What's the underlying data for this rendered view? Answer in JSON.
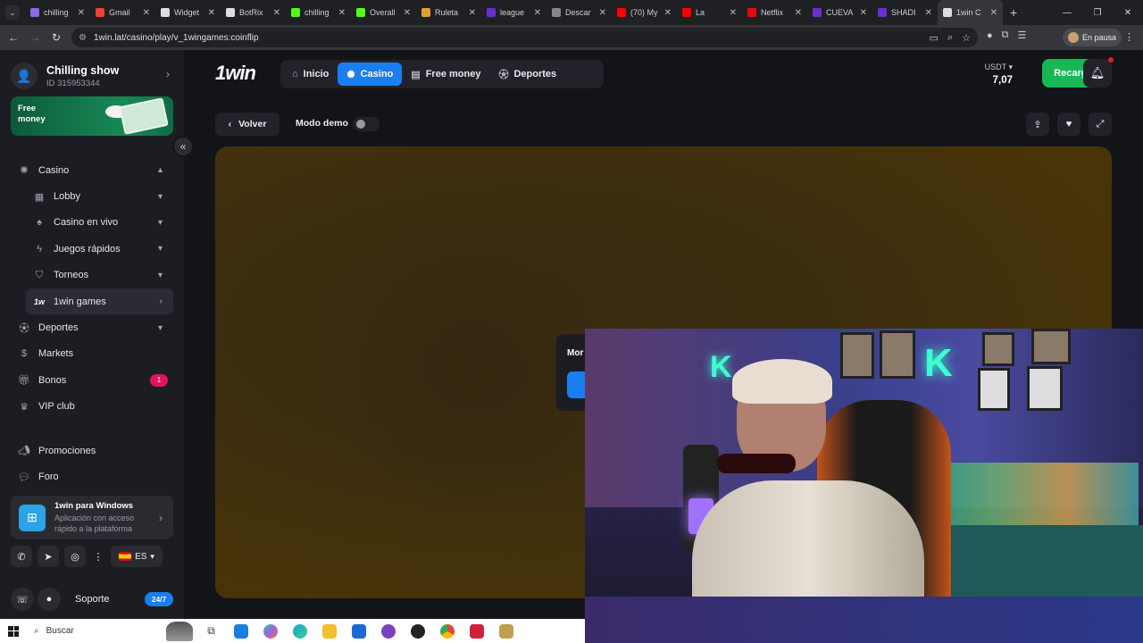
{
  "browser": {
    "tabs": [
      {
        "title": "chilling",
        "color": "#8a6ae0"
      },
      {
        "title": "Gmail",
        "color": "#ea4335"
      },
      {
        "title": "Widget",
        "color": "#dddddd"
      },
      {
        "title": "BotRix",
        "color": "#dddddd"
      },
      {
        "title": "chilling",
        "color": "#53fc18"
      },
      {
        "title": "Overall",
        "color": "#53fc18"
      },
      {
        "title": "Ruleta",
        "color": "#e0a030"
      },
      {
        "title": "league",
        "color": "#6b2fd0"
      },
      {
        "title": "Descar",
        "color": "#888888"
      },
      {
        "title": "(70) My",
        "color": "#ff0000"
      },
      {
        "title": "La",
        "color": "#ff0000"
      },
      {
        "title": "Netflix",
        "color": "#e50914"
      },
      {
        "title": "CUEVA",
        "color": "#6b2fd0"
      },
      {
        "title": "SHADI",
        "color": "#6b2fd0"
      },
      {
        "title": "1win C",
        "color": "#dddddd",
        "active": true
      }
    ],
    "url": "1win.lat/casino/play/v_1wingames:coinflip",
    "profile_status": "En pausa"
  },
  "sidebar": {
    "profile_name": "Chilling show",
    "profile_id": "ID 315953344",
    "free_money_banner": "Free money",
    "menu": [
      {
        "label": "Casino",
        "icon": "casino-chip-icon",
        "chevron": "▴"
      },
      {
        "label": "Lobby",
        "icon": "grid-icon",
        "chevron": "▾",
        "sub": true
      },
      {
        "label": "Casino en vivo",
        "icon": "spade-icon",
        "chevron": "▾",
        "sub": true
      },
      {
        "label": "Juegos rápidos",
        "icon": "bolt-icon",
        "chevron": "▾",
        "sub": true
      },
      {
        "label": "Torneos",
        "icon": "shield-icon",
        "chevron": "▾",
        "sub": true
      },
      {
        "label": "1win games",
        "icon": "1w-logo-icon",
        "chevron": "›",
        "sub": true,
        "selected": true
      },
      {
        "label": "Deportes",
        "icon": "ball-icon",
        "chevron": "▾"
      },
      {
        "label": "Markets",
        "icon": "dollar-icon",
        "chevron": ""
      },
      {
        "label": "Bonos",
        "icon": "gift-icon",
        "chevron": "",
        "badge": "1"
      },
      {
        "label": "VIP club",
        "icon": "crown-icon",
        "chevron": ""
      }
    ],
    "menu2": [
      {
        "label": "Promociones",
        "icon": "megaphone-icon"
      },
      {
        "label": "Foro",
        "icon": "chat-icon"
      }
    ],
    "windows_app": {
      "title": "1win para Windows",
      "subtitle": "Aplicación con acceso rápido a la plataforma"
    },
    "language": "ES",
    "support_label": "Soporte",
    "support_badge": "24/7"
  },
  "header": {
    "logo": "1win",
    "nav": [
      {
        "label": "Inicio",
        "icon": "home-icon"
      },
      {
        "label": "Casino",
        "icon": "casino-chip-icon",
        "active": true
      },
      {
        "label": "Free money",
        "icon": "money-icon"
      },
      {
        "label": "Deportes",
        "icon": "ball-icon"
      }
    ],
    "currency": "USDT",
    "balance": "7,07",
    "recharge_label": "Recargar"
  },
  "game_bar": {
    "back_label": "Volver",
    "demo_label": "Modo demo",
    "demo_enabled": false
  },
  "game": {
    "modal_title_partial": "Mor"
  },
  "taskbar": {
    "search_placeholder": "Buscar"
  }
}
